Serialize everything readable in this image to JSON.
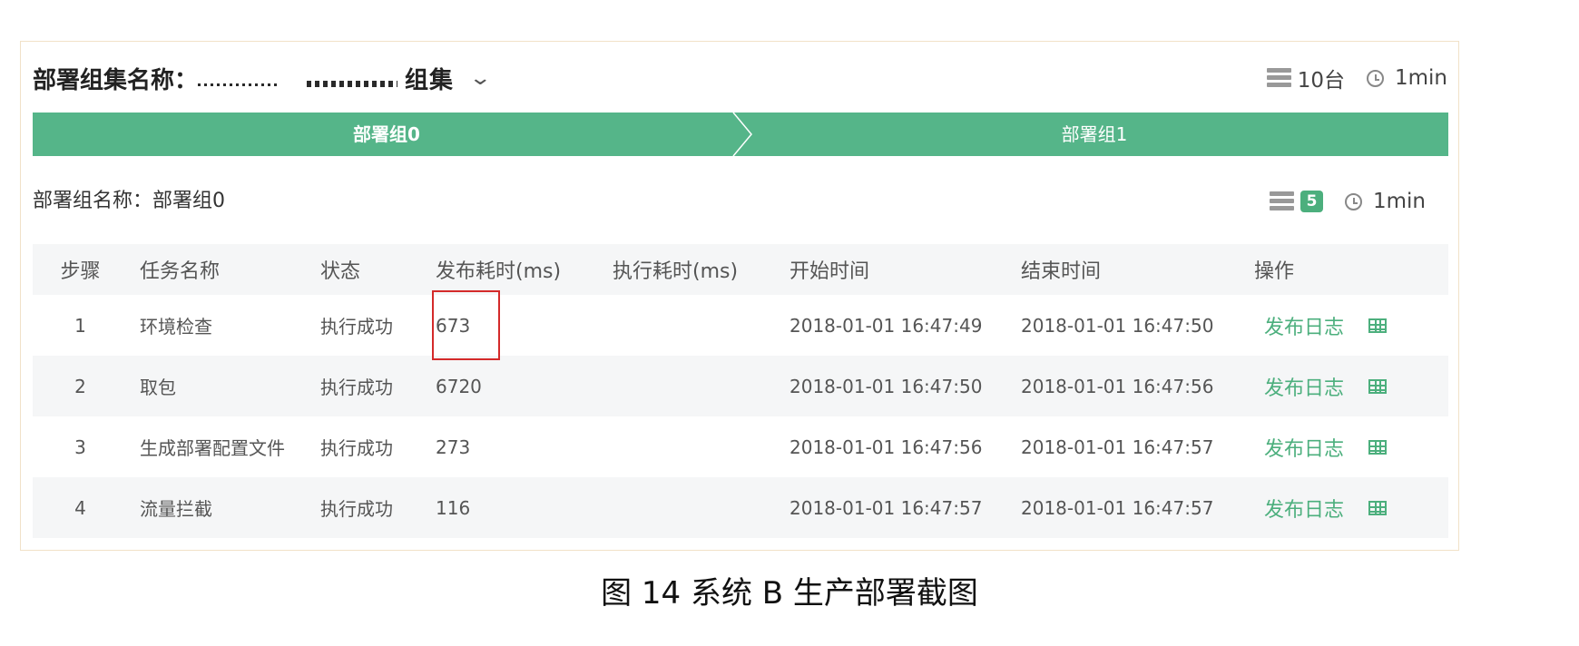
{
  "header": {
    "label": "部署组集名称：",
    "name_suffix": "组集",
    "dropdown_icon": "chevron-down-icon",
    "server_icon": "server-icon",
    "server_count": "10台",
    "clock_icon": "clock-icon",
    "duration": "1min"
  },
  "steps": [
    {
      "label": "部署组0",
      "active": true
    },
    {
      "label": "部署组1",
      "active": false
    }
  ],
  "group": {
    "label": "部署组名称：部署组0",
    "server_count": "5",
    "duration": "1min"
  },
  "table": {
    "columns": [
      "步骤",
      "任务名称",
      "状态",
      "发布耗时(ms)",
      "执行耗时(ms)",
      "开始时间",
      "结束时间",
      "操作"
    ],
    "rows": [
      {
        "step": "1",
        "task": "环境检查",
        "status": "执行成功",
        "publish_ms": "673",
        "exec_ms": "",
        "start": "2018-01-01 16:47:49",
        "end": "2018-01-01 16:47:50",
        "action": "发布日志"
      },
      {
        "step": "2",
        "task": "取包",
        "status": "执行成功",
        "publish_ms": "6720",
        "exec_ms": "",
        "start": "2018-01-01 16:47:50",
        "end": "2018-01-01 16:47:56",
        "action": "发布日志"
      },
      {
        "step": "3",
        "task": "生成部署配置文件",
        "status": "执行成功",
        "publish_ms": "273",
        "exec_ms": "",
        "start": "2018-01-01 16:47:56",
        "end": "2018-01-01 16:47:57",
        "action": "发布日志"
      },
      {
        "step": "4",
        "task": "流量拦截",
        "status": "执行成功",
        "publish_ms": "116",
        "exec_ms": "",
        "start": "2018-01-01 16:47:57",
        "end": "2018-01-01 16:47:57",
        "action": "发布日志"
      }
    ]
  },
  "caption": "图 14  系统 B 生产部署截图",
  "colors": {
    "accent": "#55b589",
    "link": "#4caf7d",
    "highlight": "#d42a2a"
  }
}
